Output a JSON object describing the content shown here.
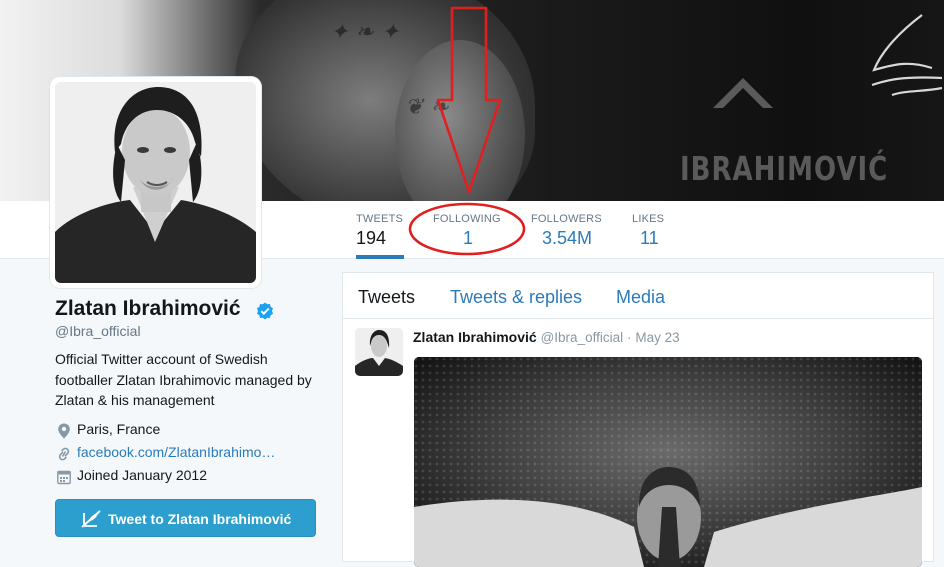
{
  "profile": {
    "name": "Zlatan Ibrahimović",
    "handle": "@Ibra_official",
    "bio": "Official Twitter account of Swedish footballer Zlatan Ibrahimovic managed by Zlatan & his management",
    "location": "Paris, France",
    "website": "facebook.com/ZlatanIbrahimo…",
    "joined": "Joined January 2012",
    "tweet_to_label": "Tweet to Zlatan Ibrahimović",
    "verified": true
  },
  "banner": {
    "jersey_text": "IBRAHIMOVIĆ"
  },
  "stats": [
    {
      "label": "TWEETS",
      "value": "194"
    },
    {
      "label": "FOLLOWING",
      "value": "1"
    },
    {
      "label": "FOLLOWERS",
      "value": "3.54M"
    },
    {
      "label": "LIKES",
      "value": "11"
    }
  ],
  "tabs": [
    {
      "label": "Tweets"
    },
    {
      "label": "Tweets & replies"
    },
    {
      "label": "Media"
    }
  ],
  "tweet": {
    "name": "Zlatan Ibrahimović",
    "handle": "@Ibra_official",
    "separator": "·",
    "date": "May 23"
  },
  "icons": {
    "verified": "verified-badge-icon",
    "location": "map-pin-icon",
    "website": "link-icon",
    "joined": "calendar-icon",
    "tweet_to": "compose-quill-icon"
  },
  "colors": {
    "accent": "#2b7bb9",
    "button": "#2d9fcf",
    "annotation": "#e0201f"
  }
}
